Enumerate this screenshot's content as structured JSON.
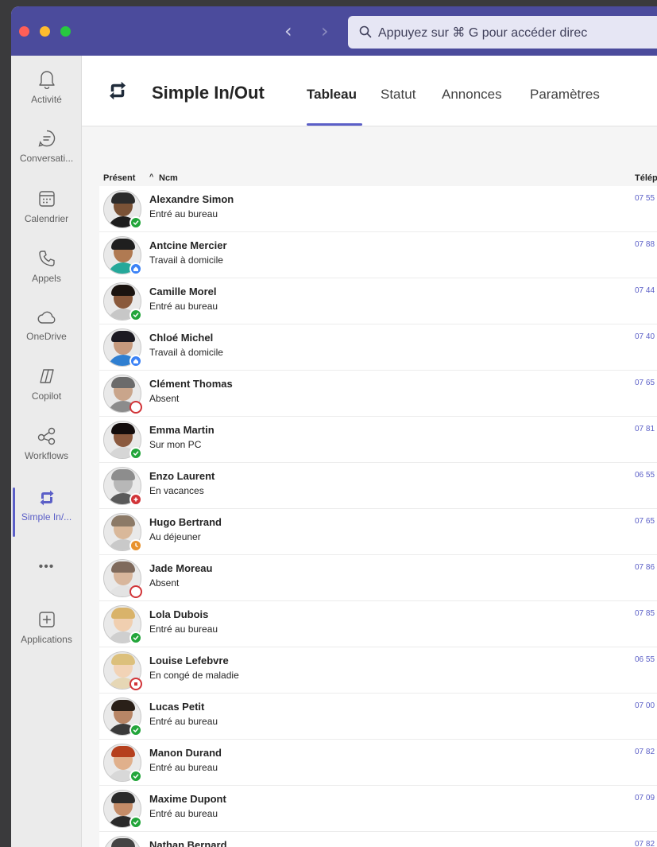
{
  "titlebar": {
    "search_placeholder": "Appuyez sur ⌘ G pour accéder direc"
  },
  "rail": {
    "items": [
      {
        "label": "Activité",
        "icon": "bell-icon"
      },
      {
        "label": "Conversati...",
        "icon": "chat-icon"
      },
      {
        "label": "Calendrier",
        "icon": "calendar-icon"
      },
      {
        "label": "Appels",
        "icon": "phone-icon"
      },
      {
        "label": "OneDrive",
        "icon": "cloud-icon"
      },
      {
        "label": "Copilot",
        "icon": "copilot-icon"
      },
      {
        "label": "Workflows",
        "icon": "workflows-icon"
      },
      {
        "label": "Simple In/...",
        "icon": "simple-in-out-icon"
      },
      {
        "label": "Applications",
        "icon": "apps-add-icon"
      }
    ],
    "more": "•••"
  },
  "app": {
    "title": "Simple In/Out",
    "tabs": [
      {
        "label": "Tableau",
        "active": true
      },
      {
        "label": "Statut",
        "active": false
      },
      {
        "label": "Annonces",
        "active": false
      },
      {
        "label": "Paramètres",
        "active": false
      }
    ]
  },
  "table": {
    "columns": {
      "present": "Présent",
      "sort_arrow": "^",
      "name": "Ncm",
      "phone": "Télép"
    },
    "rows": [
      {
        "name": "Alexandre Simon",
        "status": "Entré au bureau",
        "phone": "07 55",
        "status_type": "in"
      },
      {
        "name": "Antcine Mercier",
        "status": "Travail à domicile",
        "phone": "07 88",
        "status_type": "home"
      },
      {
        "name": "Camille Morel",
        "status": "Entré au bureau",
        "phone": "07 44",
        "status_type": "in"
      },
      {
        "name": "Chloé Michel",
        "status": "Travail à domicile",
        "phone": "07 40",
        "status_type": "home"
      },
      {
        "name": "Clément Thomas",
        "status": "Absent",
        "phone": "07 65",
        "status_type": "absent"
      },
      {
        "name": "Emma Martin",
        "status": "Sur mon PC",
        "phone": "07 81",
        "status_type": "in"
      },
      {
        "name": "Enzo Laurent",
        "status": "En vacances",
        "phone": "06 55",
        "status_type": "vacation"
      },
      {
        "name": "Hugo Bertrand",
        "status": "Au déjeuner",
        "phone": "07 65",
        "status_type": "lunch"
      },
      {
        "name": "Jade Moreau",
        "status": "Absent",
        "phone": "07 86",
        "status_type": "absent"
      },
      {
        "name": "Lola Dubois",
        "status": "Entré au bureau",
        "phone": "07 85",
        "status_type": "in"
      },
      {
        "name": "Louise Lefebvre",
        "status": "En congé de maladie",
        "phone": "06 55",
        "status_type": "sick"
      },
      {
        "name": "Lucas Petit",
        "status": "Entré au bureau",
        "phone": "07 00",
        "status_type": "in"
      },
      {
        "name": "Manon Durand",
        "status": "Entré au bureau",
        "phone": "07 82",
        "status_type": "in"
      },
      {
        "name": "Maxime Dupont",
        "status": "Entré au bureau",
        "phone": "07 09",
        "status_type": "in"
      },
      {
        "name": "Nathan Bernard",
        "status": "",
        "phone": "07 82",
        "status_type": "in"
      }
    ]
  },
  "colors": {
    "accent": "#5b5fc7",
    "titlebar": "#4b4b9c",
    "status_in": "#22a53a",
    "status_home": "#3b82f6",
    "status_absent": "#d13438",
    "status_vacation": "#d13438",
    "status_lunch": "#e8912d",
    "status_sick": "#d13438"
  }
}
